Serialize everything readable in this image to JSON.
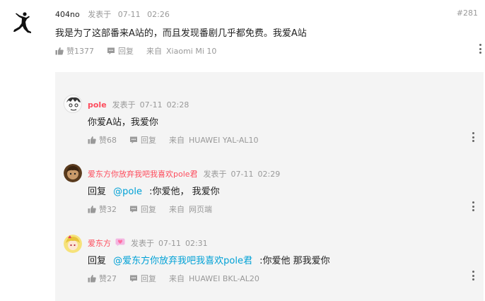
{
  "main": {
    "username": "404no",
    "posted_label": "发表于",
    "date": "07-11",
    "time": "02:26",
    "floor": "#281",
    "content": "我是为了这部番来A站的，而且发现番剧几乎都免费。我爱A站",
    "like_label": "赞1377",
    "reply_label": "回复",
    "from_label": "来自",
    "device": "Xiaomi  Mi  10"
  },
  "replies": [
    {
      "username": "pole",
      "posted_label": "发表于",
      "date": "07-11",
      "time": "02:28",
      "content": "你爱A站，我爱你",
      "like_label": "赞68",
      "reply_label": "回复",
      "from_label": "来自",
      "device": "HUAWEI  YAL-AL10"
    },
    {
      "username": "爱东方你放弃我吧我喜欢pole君",
      "posted_label": "发表于",
      "date": "07-11",
      "time": "02:29",
      "reply_prefix": "回复",
      "mention": "@pole",
      "content": ":你爱他，  我爱你",
      "like_label": "赞32",
      "reply_label": "回复",
      "from_label": "来自",
      "device": "网页端"
    },
    {
      "username": "爱东方",
      "posted_label": "发表于",
      "date": "07-11",
      "time": "02:31",
      "reply_prefix": "回复",
      "mention": "@爱东方你放弃我吧我喜欢pole君",
      "content": ":你爱他  那我爱你",
      "like_label": "赞27",
      "reply_label": "回复",
      "from_label": "来自",
      "device": "HUAWEI  BKL-AL20"
    }
  ],
  "colors": {
    "accent_name": "#fd4c5d",
    "mention": "#00a1d6",
    "muted": "#999999",
    "reply_bg": "#f4f4f4"
  },
  "icons": {
    "like": "thumbs-up-icon",
    "reply": "comment-icon",
    "more": "more-vertical-icon",
    "badge": "heart-badge-icon"
  }
}
